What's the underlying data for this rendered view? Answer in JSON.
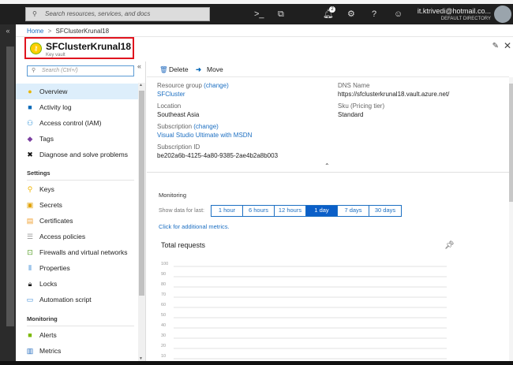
{
  "topbar": {
    "search_placeholder": "Search resources, services, and docs",
    "notification_count": "2",
    "user_email": "it.ktrivedi@hotmail.co...",
    "directory": "DEFAULT DIRECTORY"
  },
  "breadcrumb": {
    "home": "Home",
    "separator": ">",
    "current": "SFClusterKrunal18"
  },
  "header": {
    "title": "SFClusterKrunal18",
    "subtitle": "Key vault"
  },
  "sidebar": {
    "search_placeholder": "Search (Ctrl+/)",
    "items": [
      {
        "label": "Overview",
        "icon": "key-vault-icon"
      },
      {
        "label": "Activity log",
        "icon": "activity-log-icon"
      },
      {
        "label": "Access control (IAM)",
        "icon": "people-icon"
      },
      {
        "label": "Tags",
        "icon": "tag-icon"
      },
      {
        "label": "Diagnose and solve problems",
        "icon": "wrench-icon"
      }
    ],
    "settings_header": "Settings",
    "settings": [
      {
        "label": "Keys",
        "icon": "key-icon"
      },
      {
        "label": "Secrets",
        "icon": "secret-icon"
      },
      {
        "label": "Certificates",
        "icon": "certificate-icon"
      },
      {
        "label": "Access policies",
        "icon": "list-icon"
      },
      {
        "label": "Firewalls and virtual networks",
        "icon": "firewall-icon"
      },
      {
        "label": "Properties",
        "icon": "properties-icon"
      },
      {
        "label": "Locks",
        "icon": "lock-icon"
      },
      {
        "label": "Automation script",
        "icon": "monitor-icon"
      }
    ],
    "monitoring_header": "Monitoring",
    "monitoring": [
      {
        "label": "Alerts",
        "icon": "alert-icon"
      },
      {
        "label": "Metrics",
        "icon": "metrics-icon"
      }
    ]
  },
  "toolbar": {
    "delete": "Delete",
    "move": "Move"
  },
  "essentials": {
    "resource_group_label": "Resource group",
    "change": "(change)",
    "resource_group": "SFCluster",
    "location_label": "Location",
    "location": "Southeast Asia",
    "subscription_label": "Subscription",
    "subscription": "Visual Studio Ultimate with MSDN",
    "subscription_id_label": "Subscription ID",
    "subscription_id": "be202a6b-4125-4a80-9385-2ae4b2a8b003",
    "dns_label": "DNS Name",
    "dns": "https://sfclusterkrunal18.vault.azure.net/",
    "sku_label": "Sku (Pricing tier)",
    "sku": "Standard"
  },
  "monitoring": {
    "title": "Monitoring",
    "show_label": "Show data for last:",
    "ranges": [
      "1 hour",
      "6 hours",
      "12 hours",
      "1 day",
      "7 days",
      "30 days"
    ],
    "selected": "1 day",
    "more_link": "Click for additional metrics."
  },
  "chart_data": {
    "type": "line",
    "title": "Total requests",
    "yticks": [
      100,
      90,
      80,
      70,
      60,
      50,
      40,
      30,
      20,
      10
    ],
    "ylim": [
      0,
      100
    ],
    "series": [],
    "grid": true
  }
}
